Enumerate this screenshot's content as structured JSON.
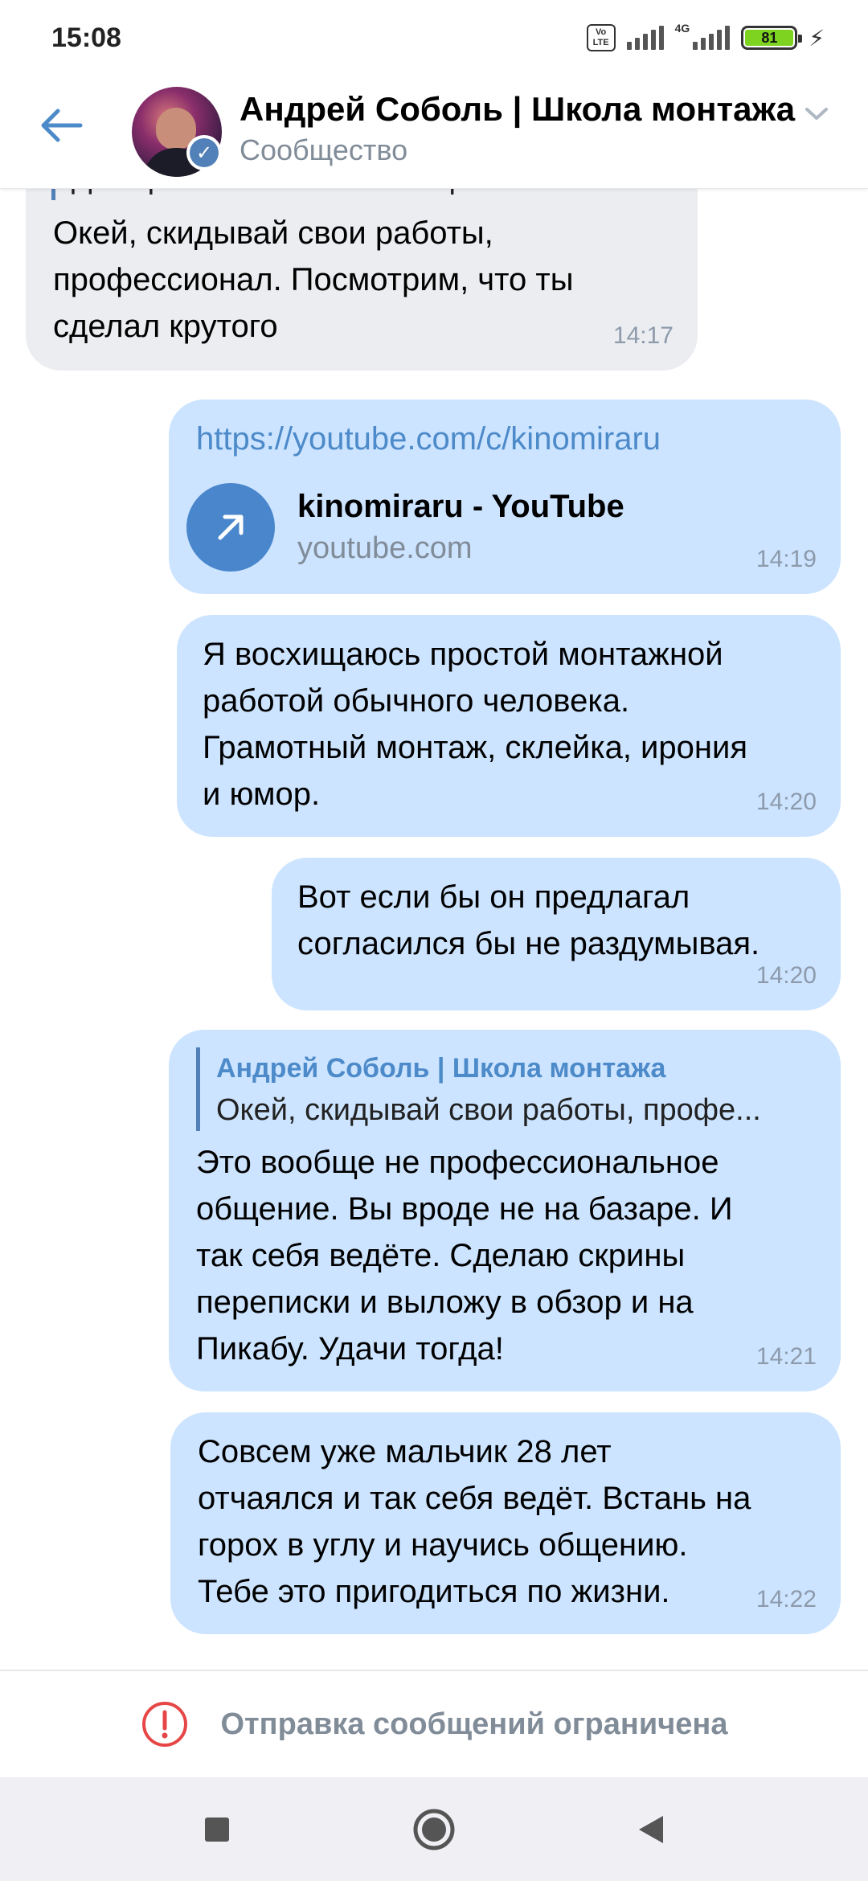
{
  "status_bar": {
    "time": "15:08",
    "network_label": "4G",
    "volte_label": "Vo LTE",
    "battery": "81"
  },
  "header": {
    "title": "Андрей Соболь | Школа монтажа",
    "subtitle": "Сообщество",
    "verified_mark": "✓"
  },
  "messages": [
    {
      "direction": "in",
      "reply_snippet": "Два три более менее выстреливают...",
      "text": "Окей, скидывай свои работы,\nпрофессионал. Посмотрим, что ты\nсделал крутого",
      "time": "14:17"
    },
    {
      "direction": "out",
      "url": "https://youtube.com/c/kinomiraru",
      "link_title": "kinomiraru - YouTube",
      "link_domain": "youtube.com",
      "time": "14:19"
    },
    {
      "direction": "out",
      "text": "Я восхищаюсь простой монтажной\nработой обычного человека.\nГрамотный монтаж, склейка, ирония\nи юмор.",
      "time": "14:20"
    },
    {
      "direction": "out",
      "text": "Вот если бы он предлагал\nсогласился бы не раздумывая.",
      "time": "14:20"
    },
    {
      "direction": "out",
      "quote_author": "Андрей Соболь | Школа монтажа",
      "quote_text": "Окей, скидывай свои работы, профе...",
      "text": "Это вообще не профессиональное\nобщение. Вы вроде не на базаре. И\nтак себя ведёте. Сделаю скрины\nпереписки и выложу в обзор и на\nПикабу. Удачи тогда!",
      "time": "14:21"
    },
    {
      "direction": "out",
      "text": "Совсем уже мальчик 28 лет\nотчаялся и так себя ведёт. Встань на\nгорох в углу и научись общению.\nТебе это пригодиться по жизни.",
      "time": "14:22"
    }
  ],
  "restricted_bar": {
    "text": "Отправка сообщений ограничена",
    "icon": "alert-circle-icon"
  },
  "colors": {
    "accent": "#5181b8",
    "incoming_bubble": "#ebedf0",
    "outgoing_bubble": "#cce4ff",
    "link": "#4d8ac9",
    "restricted_icon": "#e64646"
  }
}
